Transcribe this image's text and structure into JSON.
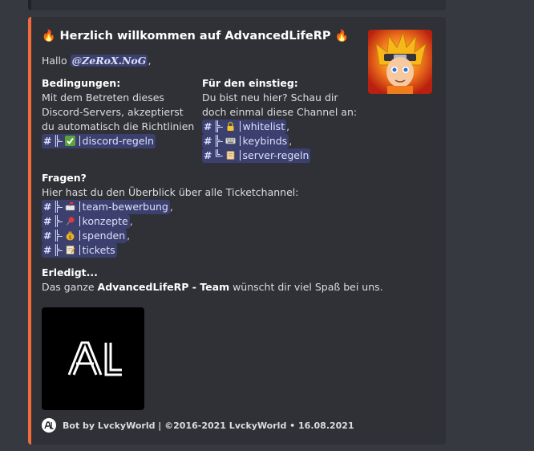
{
  "embed": {
    "accent_color": "#f26b3a",
    "title_prefix_emoji": "🔥",
    "title": "Herzlich willkommen auf AdvancedLifeRP",
    "title_suffix_emoji": "🔥",
    "greeting_prefix": "Hallo ",
    "mention": "@𝒁𝒆𝑹𝒐𝑿.𝑵𝒐𝑮",
    "greeting_suffix": ",",
    "fields": {
      "conditions": {
        "name": "Bedingungen:",
        "text": "Mit dem Betreten dieses Discord-Servers, akzeptierst du automatisch die Richtlinien",
        "channels": [
          {
            "name": "discord-regeln",
            "icon": "check-mark-icon",
            "tree": "╠-"
          }
        ]
      },
      "beginners": {
        "name": "Für den einstieg:",
        "text": "Du bist neu hier? Schau dir doch einmal diese Channel an:",
        "channels": [
          {
            "name": "whitelist",
            "icon": "lock-icon",
            "tree": "╠-"
          },
          {
            "name": "keybinds",
            "icon": "keyboard-icon",
            "tree": "╠-"
          },
          {
            "name": "server-regeln",
            "icon": "scroll-icon",
            "tree": "╚-"
          }
        ]
      },
      "questions": {
        "name": "Fragen?",
        "text": "Hier hast du den Überblick über alle Ticketchannel:",
        "channels": [
          {
            "name": "team-bewerbung",
            "icon": "mailbox-icon",
            "tree": "╠-"
          },
          {
            "name": "konzepte",
            "icon": "pushpin-icon",
            "tree": "╠-"
          },
          {
            "name": "spenden",
            "icon": "money-bag-icon",
            "tree": "╠-"
          },
          {
            "name": "tickets",
            "icon": "memo-icon",
            "tree": "╠-"
          }
        ]
      },
      "done": {
        "name": "Erledigt...",
        "text_prefix": "Das ganze ",
        "text_bold": "AdvancedLifeRP - Team",
        "text_suffix": " wünscht dir viel Spaß bei uns."
      }
    },
    "image_logo_text": "AL",
    "footer": {
      "text": "Bot by LvckyWorld | ©2016-2021 LvckyWorld",
      "separator": " • ",
      "date": "16.08.2021"
    }
  }
}
